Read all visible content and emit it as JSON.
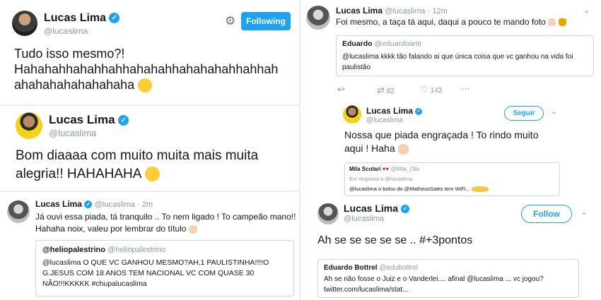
{
  "tweet1": {
    "name": "Lucas Lima",
    "handle": "@lucaslima",
    "follow_label": "Following",
    "line1": "Tudo isso mesmo?!",
    "line2": "Hahahahhahahhahhahahahhahahahahhahhah",
    "line3": "ahahahahahahahaha",
    "emoji": "thinking-face"
  },
  "tweet2": {
    "name": "Lucas Lima",
    "handle": "@lucaslima",
    "line1": "Bom diaaaa com muito muita mais muita",
    "line2": "alegria!! HAHAHAHA"
  },
  "tweet3": {
    "name": "Lucas Lima",
    "handle": "@lucaslima",
    "time": "2m",
    "line1": "Já ouvi essa piada, tá tranquilo .. To nem ligado ! To campeão mano!!",
    "line2": "Hahaha noix, valeu por lembrar do título",
    "quote": {
      "author": "@heliopalestrino",
      "handle": "@heliopalestrino",
      "line1": "@lucaslima O QUE VC GANHOU MESMO?AH,1 PAULISTINHA!!!!O",
      "line2": "G.JESUS COM 18 ANOS TEM NACIONAL VC COM QUASE 30",
      "line3": "NÃO!!!KKKKK #chupalucaslima"
    }
  },
  "tweet4": {
    "name": "Lucas Lima",
    "handle": "@lucaslima",
    "time": "12m",
    "text": "Foi mesmo, a taça tá aqui, daqui a pouco te mando foto",
    "quote": {
      "author": "Eduardo",
      "handle": "@eduardoantr",
      "line1": "@lucaslima kkkk tão falando ai que única coisa que vc ganhou na vida foi",
      "line2": "paulistão"
    },
    "retweets": "82",
    "likes": "143"
  },
  "tweet5": {
    "name": "Lucas Lima",
    "handle": "@lucaslima",
    "follow_label": "Seguir",
    "line1": "Nossa que piada engraçada ! To rindo muito",
    "line2": "aqui ! Haha",
    "quote": {
      "author": "Mila Scolari",
      "handle": "@Mila_Oliv",
      "reply_to": "Em resposta a @lucaslima",
      "text": "@lucaslima o bolso do @MatheusSales tem WiFi..."
    }
  },
  "tweet6": {
    "name": "Lucas Lima",
    "handle": "@lucaslima",
    "follow_label": "Follow",
    "text": "Ah se se se se se .. #+3pontos",
    "quote": {
      "author": "Eduardo Bottrel",
      "handle": "@edubottrel",
      "line1": "Ah se não fosse o Juiz e o Vanderlei.... afinal @lucaslima ... vc jogou?",
      "line2": "twitter.com/lucaslima/stat..."
    }
  },
  "colors": {
    "accent": "#1da1f2",
    "muted": "#8899a6",
    "border": "#ccd6dd"
  }
}
